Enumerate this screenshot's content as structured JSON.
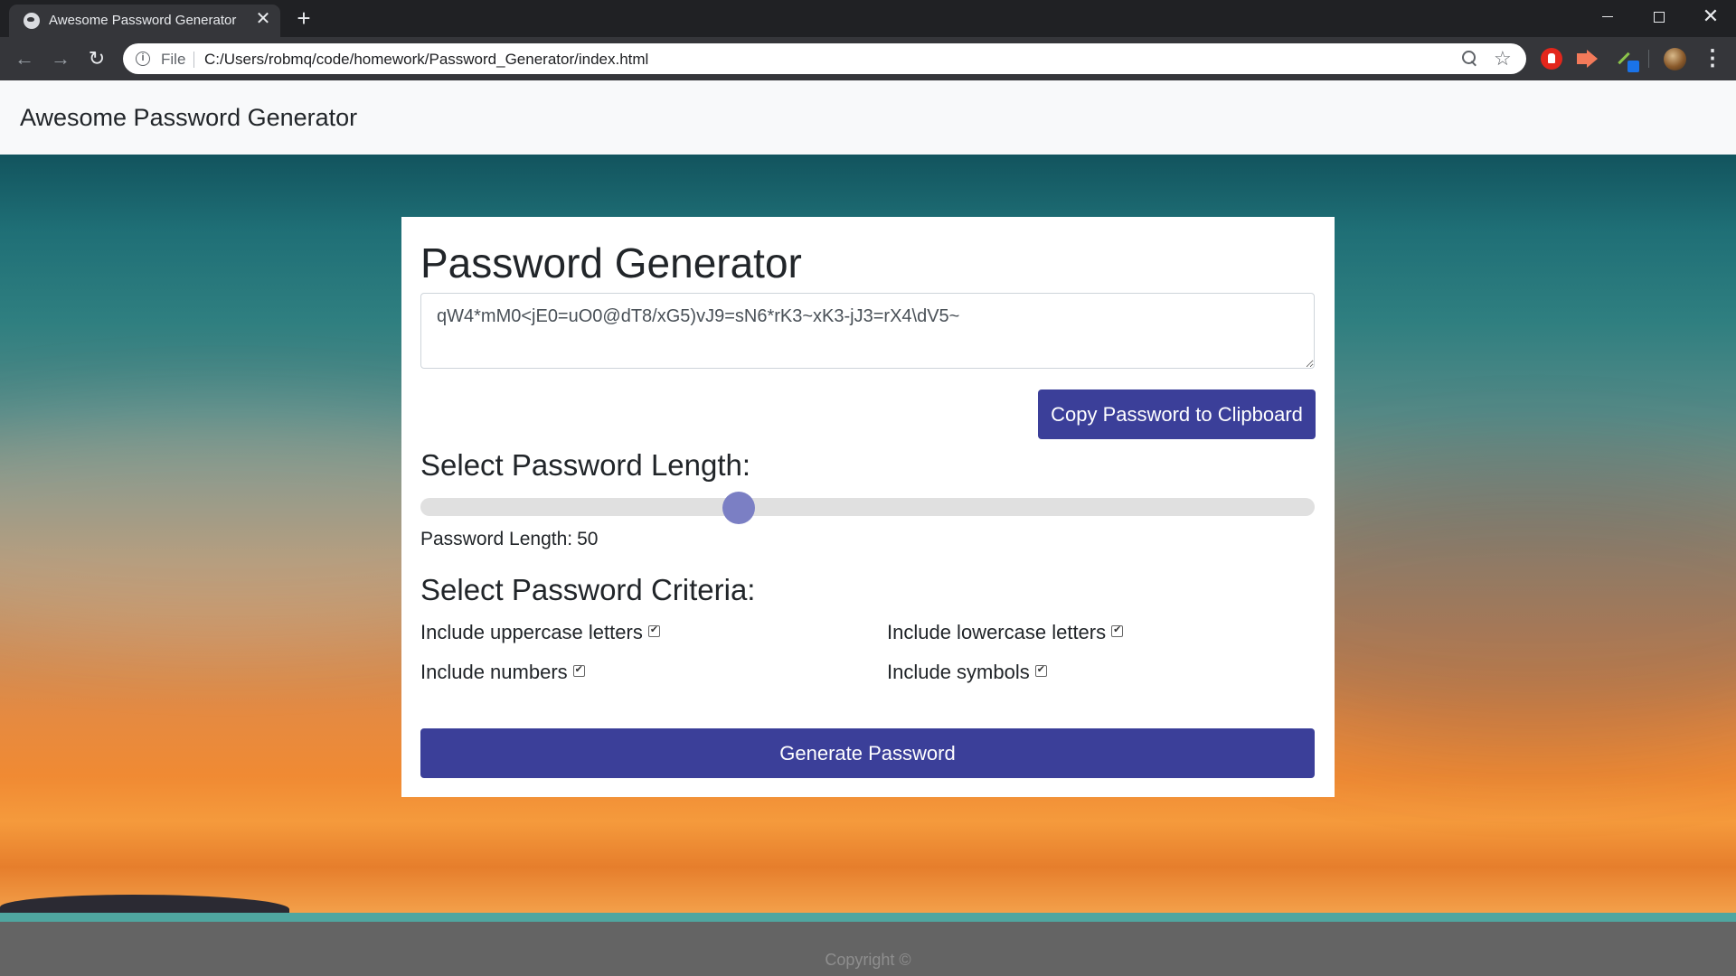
{
  "browser": {
    "tab_title": "Awesome Password Generator",
    "tab_close": "✕",
    "new_tab": "+",
    "scheme": "File",
    "url": "C:/Users/robmq/code/homework/Password_Generator/index.html",
    "icons": [
      "globe-icon",
      "back-icon",
      "forward-icon",
      "reload-icon",
      "info-icon",
      "zoom-icon",
      "star-icon",
      "menu-icon"
    ]
  },
  "navbar": {
    "brand": "Awesome Password Generator"
  },
  "card": {
    "title": "Password Generator",
    "password": "qW4*mM0<jE0=uO0@dT8/xG5)vJ9=sN6*rK3~xK3-jJ3=rX4\\dV5~",
    "copy_button": "Copy Password to Clipboard",
    "length_section_title": "Select Password Length:",
    "length_label": "Password Length:",
    "length_value": "50",
    "slider": {
      "min": 8,
      "max": 128,
      "value": 50
    },
    "criteria_section_title": "Select Password Criteria:",
    "criteria": {
      "uppercase": {
        "label": "Include uppercase letters",
        "checked": true
      },
      "lowercase": {
        "label": "Include lowercase letters",
        "checked": true
      },
      "numbers": {
        "label": "Include numbers",
        "checked": true
      },
      "symbols": {
        "label": "Include symbols",
        "checked": true
      }
    },
    "generate_button": "Generate Password"
  },
  "footer": {
    "text": "Copyright ©"
  },
  "colors": {
    "primary_button": "#3b3f99",
    "slider_thumb": "#7b7fc4",
    "footer_bg": "#646464"
  }
}
